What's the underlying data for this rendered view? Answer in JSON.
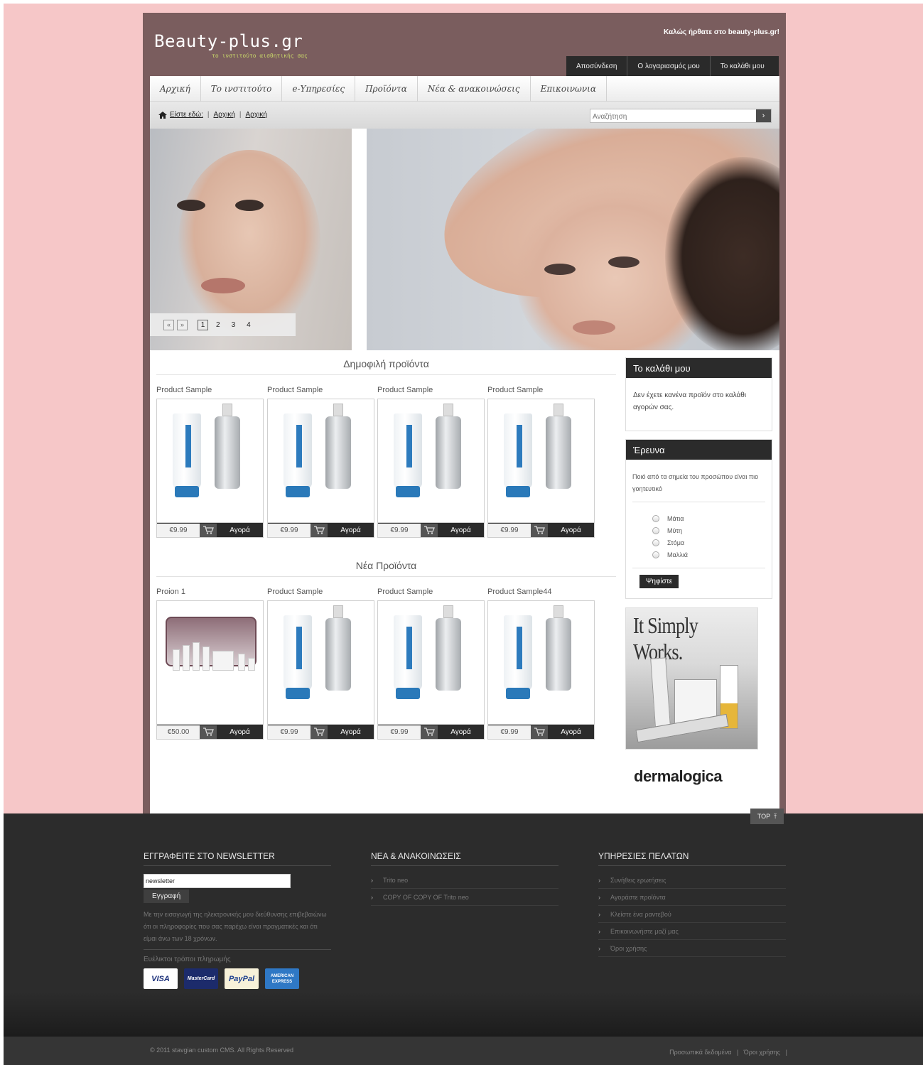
{
  "header": {
    "logo": "Beauty-plus.gr",
    "tagline": "το ινστιτούτο αισθητικής σας",
    "welcome": "Καλώς ήρθατε στο beauty-plus.gr!",
    "user_links": [
      "Αποσύνδεση",
      "Ο λογαριασμός μου",
      "Το καλάθι μου"
    ]
  },
  "nav": {
    "items": [
      "Αρχική",
      "Το ινστιτούτο",
      "e-Υπηρεσίες",
      "Προϊόντα",
      "Νέα & ανακοινώσεις",
      "Επικοινωνια"
    ]
  },
  "breadcrumb": {
    "label": "Είστε εδώ:",
    "items": [
      "Αρχική",
      "Αρχική"
    ]
  },
  "search": {
    "placeholder": "Αναζήτηση",
    "button": "›"
  },
  "slider": {
    "prev": "«",
    "next": "»",
    "pages": [
      "1",
      "2",
      "3",
      "4"
    ],
    "current": "1"
  },
  "popular": {
    "title": "Δημοφιλή προϊόντα",
    "products": [
      {
        "name": "Product Sample",
        "price": "€9.99",
        "buy": "Αγορά"
      },
      {
        "name": "Product Sample",
        "price": "€9.99",
        "buy": "Αγορά"
      },
      {
        "name": "Product Sample",
        "price": "€9.99",
        "buy": "Αγορά"
      },
      {
        "name": "Product Sample",
        "price": "€9.99",
        "buy": "Αγορά"
      }
    ]
  },
  "new_products": {
    "title": "Νέα Προϊόντα",
    "products": [
      {
        "name": "Proion 1",
        "price": "€50.00",
        "buy": "Αγορά"
      },
      {
        "name": "Product Sample",
        "price": "€9.99",
        "buy": "Αγορά"
      },
      {
        "name": "Product Sample",
        "price": "€9.99",
        "buy": "Αγορά"
      },
      {
        "name": "Product Sample44",
        "price": "€9.99",
        "buy": "Αγορά"
      }
    ]
  },
  "sidebar": {
    "cart_title": "Το καλάθι μου",
    "cart_empty": "Δεν έχετε κανένα προϊόν στο καλάθι αγορών σας.",
    "poll_title": "Έρευνα",
    "poll_question": "Ποιό από τα σημεία του προσώπου είναι πιο γοητευτικό",
    "poll_options": [
      "Μάτια",
      "Μύτη",
      "Στόμα",
      "Μαλλιά"
    ],
    "vote_button": "Ψηφίστε",
    "ad_title": "It Simply Works.",
    "brand_logo": "dermalogica"
  },
  "footer": {
    "top_button": "TOP",
    "newsletter_title": "ΕΓΓΡΑΦΕΙΤΕ ΣΤΟ NEWSLETTER",
    "newsletter_value": "newsletter",
    "newsletter_button": "Εγγραφή",
    "newsletter_text": "Με την εισαγωγή της ηλεκτρονικής μου διεύθυνσης επιβεβαιώνω ότι οι πληροφορίες που σας παρέχω είναι πραγματικές και ότι είμαι άνω των 18 χρόνων.",
    "payment_title": "Ευέλικτοι τρόποι πληρωμής",
    "cards": [
      "VISA",
      "MasterCard",
      "PayPal",
      "AMERICAN EXPRESS"
    ],
    "news_title": "ΝΕΑ & ΑΝΑΚΟΙΝΩΣΕΙΣ",
    "news_items": [
      "Trito neo",
      "COPY OF COPY OF Trito neo"
    ],
    "services_title": "ΥΠΗΡΕΣΙΕΣ ΠΕΛΑΤΩΝ",
    "services_items": [
      "Συνήθεις ερωτήσεις",
      "Αγοράστε προϊόντα",
      "Κλείστε ένα ραντεβού",
      "Επικοινωνήστε μαζί μας",
      "Όροι χρήσης"
    ],
    "copyright": "© 2011 stavgian custom CMS. All Rights Reserved",
    "bottom_links": [
      "Προσωπικά δεδομένα",
      "Όροι χρήσης"
    ]
  },
  "colors": {
    "page_bg": "#f6c7c8",
    "frame": "#7a5d5e",
    "dark": "#2b2b2b"
  }
}
